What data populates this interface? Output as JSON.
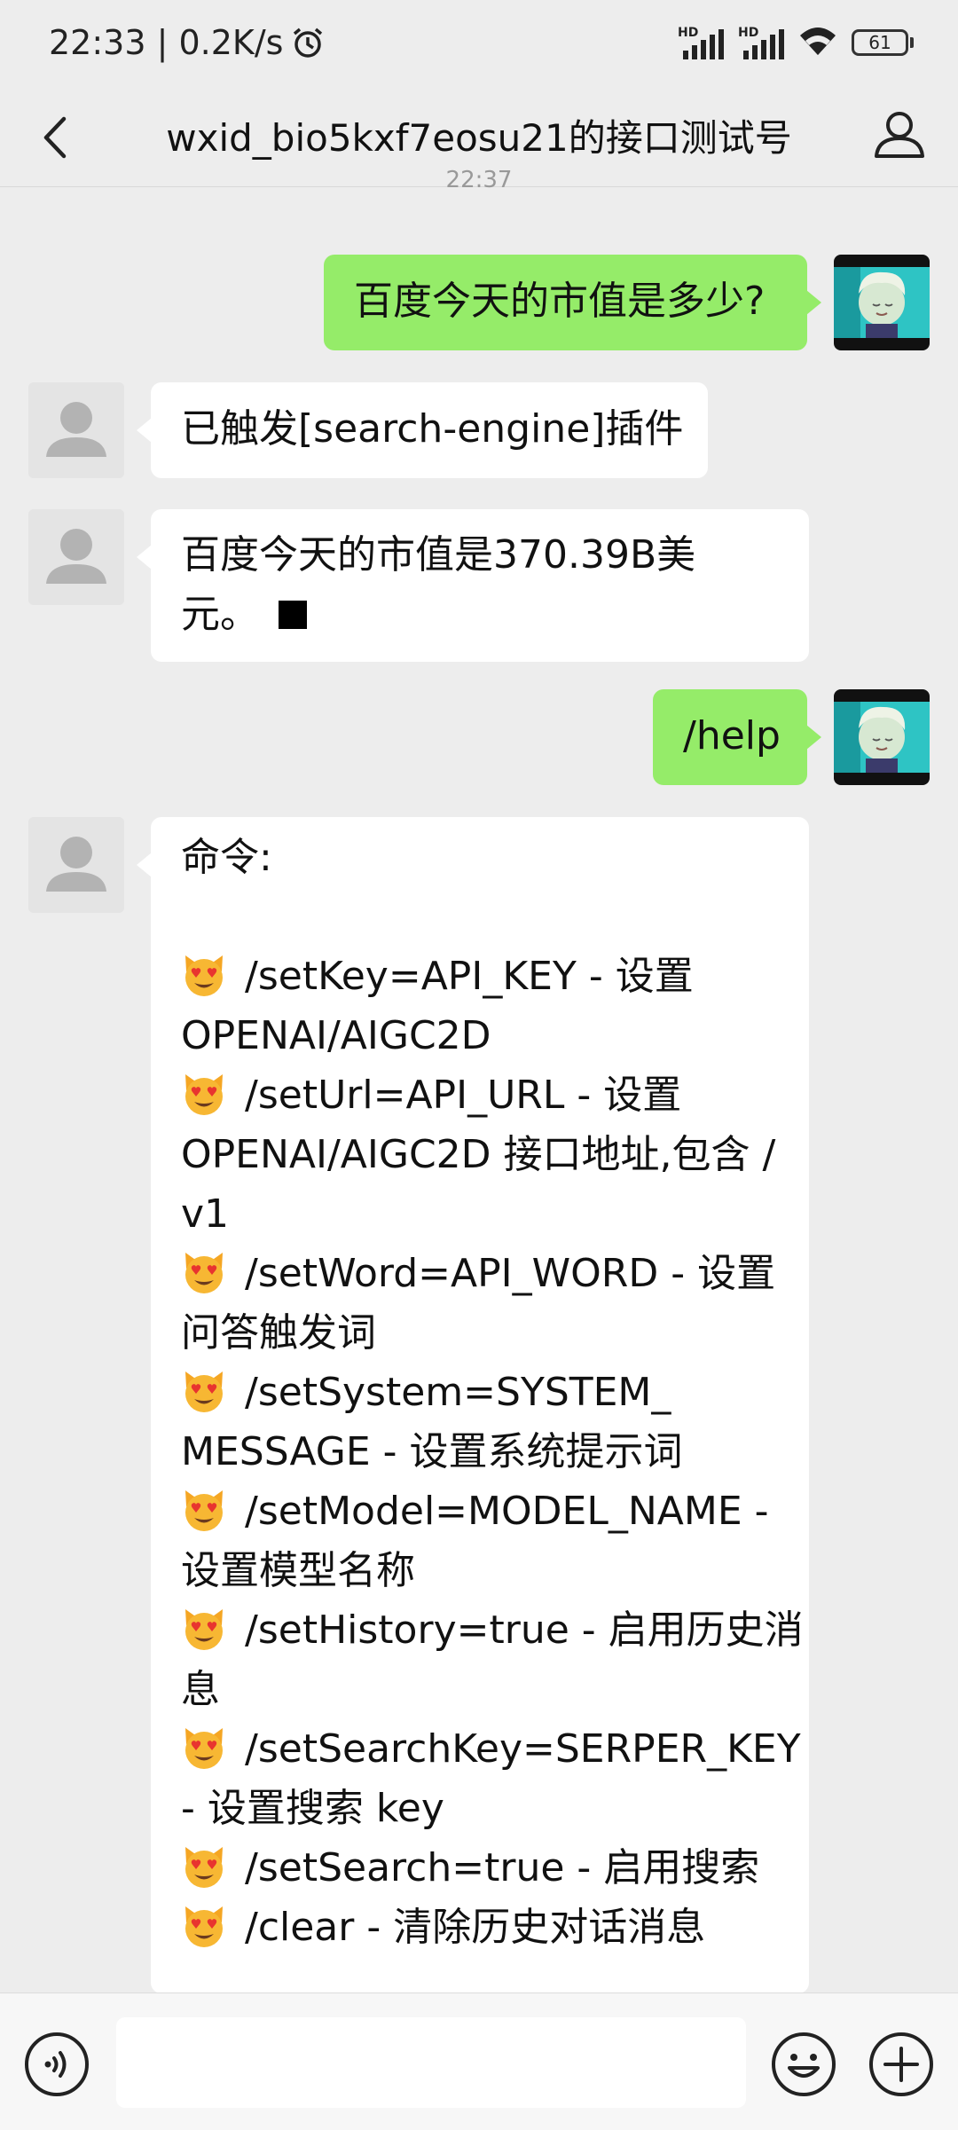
{
  "status": {
    "time_speed": "22:33 | 0.2K/s",
    "hd_label": "HD",
    "battery": "61"
  },
  "header": {
    "title": "wxid_bio5kxf7eosu21的接口测试号",
    "timestamp": "22:37"
  },
  "messages": [
    {
      "from": "self",
      "text": "百度今天的市值是多少?"
    },
    {
      "from": "bot",
      "text": "已触发[search-engine]插件"
    },
    {
      "from": "bot",
      "lines": [
        "百度今天的市值是370.39B美",
        "元。"
      ]
    },
    {
      "from": "self",
      "text": "/help"
    },
    {
      "from": "bot",
      "heading": "命令:",
      "emoji": "smiling-cat-heart-eyes",
      "lines": [
        "/setKey=API_KEY - 设置",
        "OPENAI/AIGC2D",
        "/setUrl=API_URL - 设置",
        "OPENAI/AIGC2D 接口地址,包含 /",
        "v1",
        "/setWord=API_WORD - 设置",
        "问答触发词",
        "/setSystem=SYSTEM_",
        "MESSAGE - 设置系统提示词",
        "/setModel=MODEL_NAME -",
        "设置模型名称",
        "/setHistory=true - 启用历史消",
        "息",
        "/setSearchKey=SERPER_KEY",
        "- 设置搜索 key",
        "/setSearch=true - 启用搜索",
        "/clear - 清除历史对话消息"
      ]
    }
  ],
  "input": {
    "value": "",
    "placeholder": ""
  },
  "icons": {
    "back": "chevron-left-icon",
    "profile": "person-icon",
    "voice": "voice-icon",
    "emoji": "emoji-smile-icon",
    "plus": "plus-icon"
  },
  "colors": {
    "background": "#ededed",
    "outgoing_bubble": "#95ec69",
    "incoming_bubble": "#ffffff",
    "input_bar": "#f7f7f7"
  }
}
